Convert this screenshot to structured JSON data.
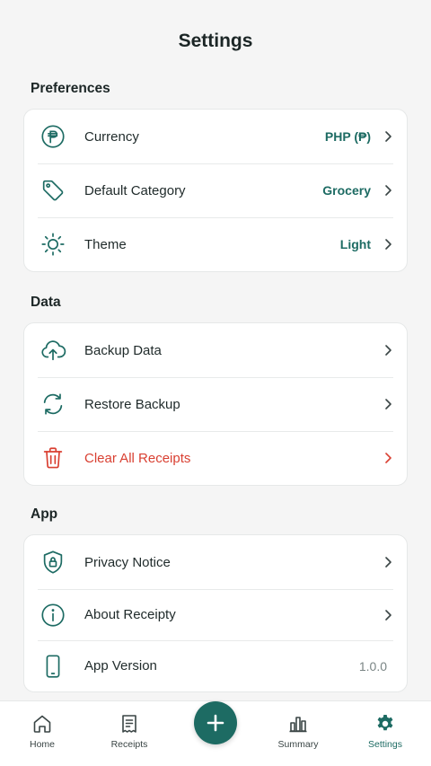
{
  "page": {
    "title": "Settings"
  },
  "colors": {
    "accent": "#1d6b63",
    "danger": "#d94032",
    "background": "#f5f5f5"
  },
  "sections": {
    "preferences": {
      "title": "Preferences",
      "items": [
        {
          "label": "Currency",
          "value": "PHP (₱)",
          "icon": "peso-coin-icon"
        },
        {
          "label": "Default Category",
          "value": "Grocery",
          "icon": "tag-icon"
        },
        {
          "label": "Theme",
          "value": "Light",
          "icon": "sun-icon"
        }
      ]
    },
    "data": {
      "title": "Data",
      "items": [
        {
          "label": "Backup Data",
          "icon": "cloud-upload-icon"
        },
        {
          "label": "Restore Backup",
          "icon": "refresh-icon"
        },
        {
          "label": "Clear All Receipts",
          "icon": "trash-icon"
        }
      ]
    },
    "app": {
      "title": "App",
      "items": [
        {
          "label": "Privacy Notice",
          "icon": "shield-lock-icon"
        },
        {
          "label": "About Receipty",
          "icon": "info-icon"
        },
        {
          "label": "App Version",
          "value": "1.0.0",
          "icon": "phone-icon"
        }
      ]
    }
  },
  "nav": {
    "items": [
      {
        "label": "Home",
        "icon": "home-icon"
      },
      {
        "label": "Receipts",
        "icon": "receipt-icon"
      },
      {
        "label": "Summary",
        "icon": "bar-chart-icon"
      },
      {
        "label": "Settings",
        "icon": "gear-icon",
        "active": true
      }
    ],
    "fab_icon": "plus-icon"
  }
}
